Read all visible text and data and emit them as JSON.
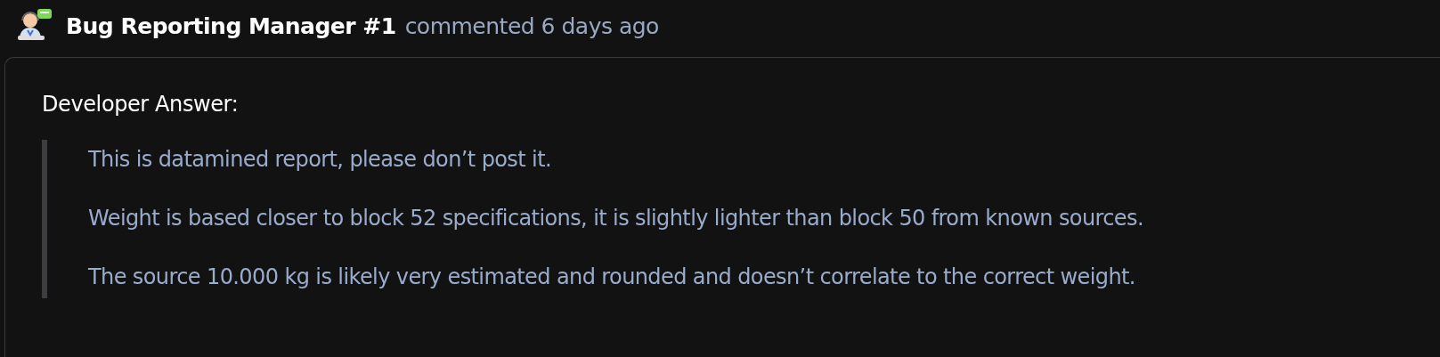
{
  "comment": {
    "author": "Bug Reporting Manager #1",
    "action": "commented 6 days ago",
    "heading": "Developer Answer:",
    "quote": [
      "This is datamined report, please don’t post it.",
      "Weight is based closer to block 52 specifications, it is slightly lighter than block 50 from known sources.",
      "The source 10.000 kg is likely very estimated and rounded and doesn’t correlate to the correct weight."
    ]
  }
}
